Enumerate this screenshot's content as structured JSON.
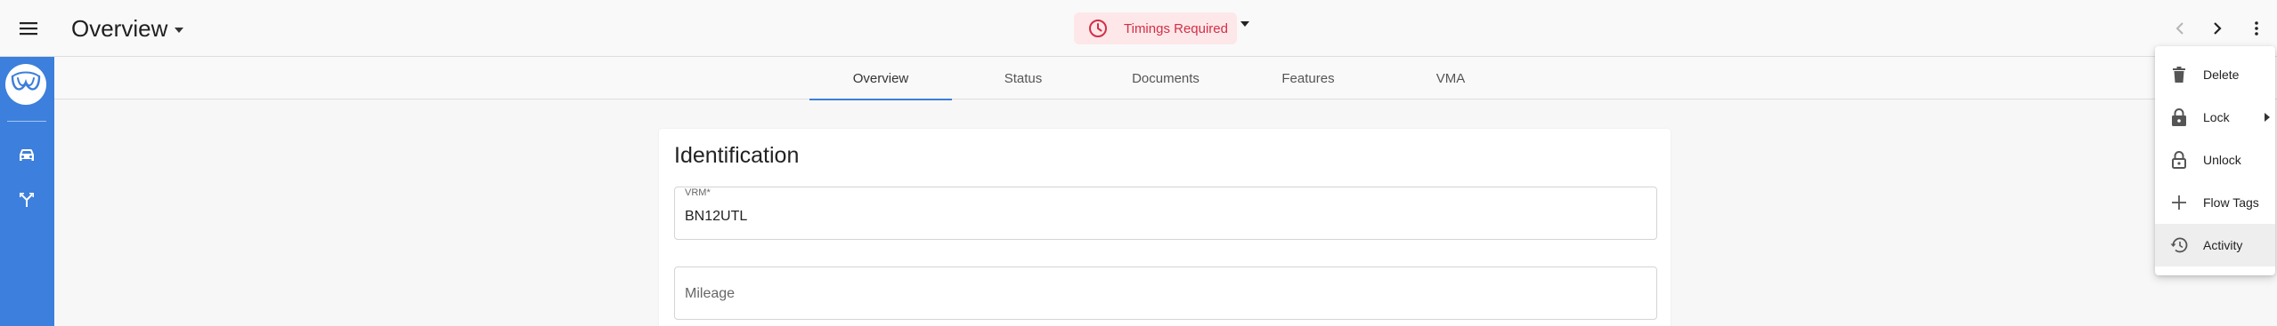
{
  "header": {
    "title": "Overview",
    "timings_status": "Timings Required",
    "timings_color": "#d32f46"
  },
  "rail": {
    "accent_color": "#3c7fdc",
    "items": [
      {
        "name": "car-icon"
      },
      {
        "name": "flow-icon"
      }
    ]
  },
  "tabs": [
    {
      "label": "Overview",
      "active": true
    },
    {
      "label": "Status",
      "active": false
    },
    {
      "label": "Documents",
      "active": false
    },
    {
      "label": "Features",
      "active": false
    },
    {
      "label": "VMA",
      "active": false
    }
  ],
  "identification": {
    "title": "Identification",
    "vrm": {
      "label": "VRM*",
      "value": "BN12UTL"
    },
    "mileage": {
      "placeholder": "Mileage",
      "value": ""
    }
  },
  "menu": {
    "items": [
      {
        "label": "Delete",
        "icon": "trash-icon"
      },
      {
        "label": "Lock",
        "icon": "lock-icon",
        "submenu": true
      },
      {
        "label": "Unlock",
        "icon": "unlock-icon"
      },
      {
        "label": "Flow Tags",
        "icon": "plus-icon"
      },
      {
        "label": "Activity",
        "icon": "history-icon",
        "highlighted": true
      }
    ]
  }
}
